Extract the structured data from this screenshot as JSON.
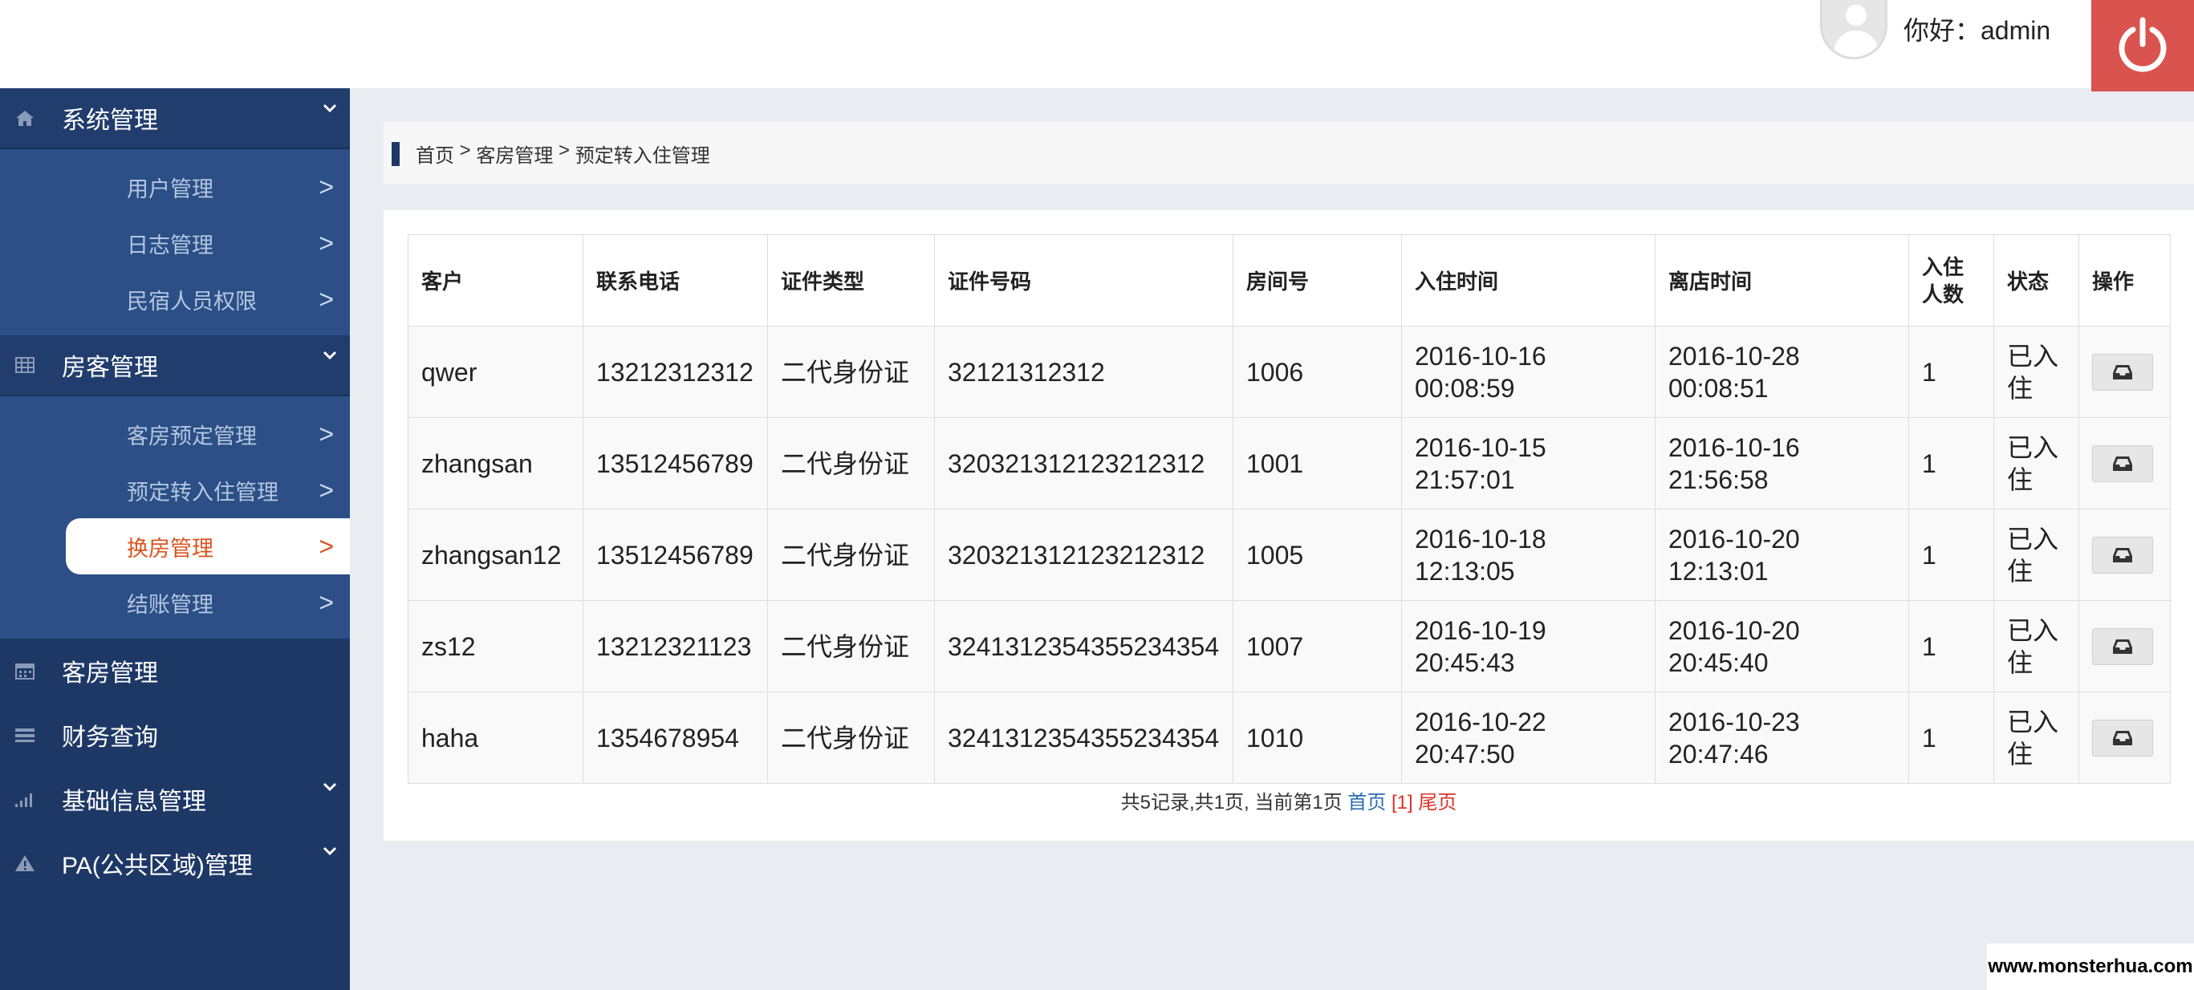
{
  "header": {
    "greeting": "你好：admin",
    "logout_color": "#d9534f"
  },
  "sidebar": {
    "groups": [
      {
        "label": "系统管理",
        "icon": "home-icon",
        "items": [
          {
            "label": "用户管理",
            "arrow": ">"
          },
          {
            "label": "日志管理",
            "arrow": ">"
          },
          {
            "label": "民宿人员权限",
            "arrow": ">"
          }
        ]
      },
      {
        "label": "房客管理",
        "icon": "grid-icon",
        "items": [
          {
            "label": "客房预定管理",
            "arrow": ">"
          },
          {
            "label": "预定转入住管理",
            "arrow": ">"
          },
          {
            "label": "换房管理",
            "arrow": ">"
          },
          {
            "label": "结账管理",
            "arrow": ">"
          }
        ]
      },
      {
        "label": "客房管理",
        "icon": "calendar-icon"
      },
      {
        "label": "财务查询",
        "icon": "list-icon"
      },
      {
        "label": "基础信息管理",
        "icon": "signal-icon"
      },
      {
        "label": "PA(公共区域)管理",
        "icon": "warning-icon"
      }
    ],
    "active_item": "换房管理"
  },
  "breadcrumb": {
    "home": "首页",
    "sep": " > ",
    "level1": "客房管理",
    "level2": "预定转入住管理"
  },
  "table": {
    "columns": [
      "客户",
      "联系电话",
      "证件类型",
      "证件号码",
      "房间号",
      "入住时间",
      "离店时间",
      "入住人数",
      "状态",
      "操作"
    ],
    "rows": [
      {
        "customer": "qwer",
        "phone": "13212312312",
        "id_type": "二代身份证",
        "id_no": "32121312312",
        "room": "1006",
        "checkin_date": "2016-10-16",
        "checkin_time": "00:08:59",
        "checkout_date": "2016-10-28",
        "checkout_time": "00:08:51",
        "guests": "1",
        "status": "已入住"
      },
      {
        "customer": "zhangsan",
        "phone": "13512456789",
        "id_type": "二代身份证",
        "id_no": "320321312123212312",
        "room": "1001",
        "checkin_date": "2016-10-15",
        "checkin_time": "21:57:01",
        "checkout_date": "2016-10-16",
        "checkout_time": "21:56:58",
        "guests": "1",
        "status": "已入住"
      },
      {
        "customer": "zhangsan12",
        "phone": "13512456789",
        "id_type": "二代身份证",
        "id_no": "320321312123212312",
        "room": "1005",
        "checkin_date": "2016-10-18",
        "checkin_time": "12:13:05",
        "checkout_date": "2016-10-20",
        "checkout_time": "12:13:01",
        "guests": "1",
        "status": "已入住"
      },
      {
        "customer": "zs12",
        "phone": "13212321123",
        "id_type": "二代身份证",
        "id_no": "3241312354355234354",
        "room": "1007",
        "checkin_date": "2016-10-19",
        "checkin_time": "20:45:43",
        "checkout_date": "2016-10-20",
        "checkout_time": "20:45:40",
        "guests": "1",
        "status": "已入住"
      },
      {
        "customer": "haha",
        "phone": "1354678954",
        "id_type": "二代身份证",
        "id_no": "3241312354355234354",
        "room": "1010",
        "checkin_date": "2016-10-22",
        "checkin_time": "20:47:50",
        "checkout_date": "2016-10-23",
        "checkout_time": "20:47:46",
        "guests": "1",
        "status": "已入住"
      }
    ],
    "row_action_icon": "inbox-icon"
  },
  "pager": {
    "summary": "共5记录,共1页, 当前第1页 ",
    "first": "首页",
    "current": " [1] ",
    "last": "尾页"
  },
  "watermark": "www.monsterhua.com"
}
